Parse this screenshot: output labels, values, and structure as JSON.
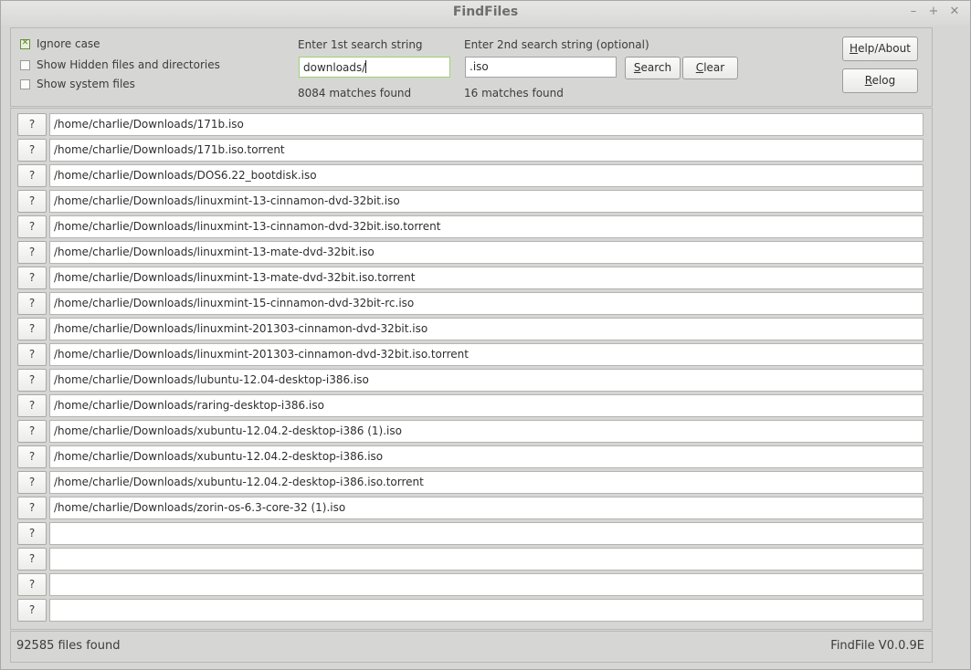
{
  "window": {
    "title": "FindFiles",
    "controls": {
      "minimize": "–",
      "maximize": "+",
      "close": "✕"
    }
  },
  "options": {
    "ignore_case": {
      "label": "Ignore case",
      "checked": true
    },
    "show_hidden": {
      "label": "Show Hidden files and directories",
      "checked": false
    },
    "show_system": {
      "label": "Show system files",
      "checked": false
    }
  },
  "search1": {
    "label": "Enter 1st search string",
    "value": "downloads/",
    "matches": "8084 matches found"
  },
  "search2": {
    "label": "Enter 2nd search string (optional)",
    "value": ".iso",
    "matches": "16 matches found"
  },
  "buttons": {
    "search": {
      "first": "S",
      "rest": "earch"
    },
    "clear": {
      "first": "C",
      "rest": "lear"
    },
    "help": {
      "first": "H",
      "rest": "elp/About"
    },
    "relog": {
      "first": "R",
      "rest": "elog"
    }
  },
  "results": {
    "row_button_label": "?",
    "rows": [
      "/home/charlie/Downloads/171b.iso",
      "/home/charlie/Downloads/171b.iso.torrent",
      "/home/charlie/Downloads/DOS6.22_bootdisk.iso",
      "/home/charlie/Downloads/linuxmint-13-cinnamon-dvd-32bit.iso",
      "/home/charlie/Downloads/linuxmint-13-cinnamon-dvd-32bit.iso.torrent",
      "/home/charlie/Downloads/linuxmint-13-mate-dvd-32bit.iso",
      "/home/charlie/Downloads/linuxmint-13-mate-dvd-32bit.iso.torrent",
      "/home/charlie/Downloads/linuxmint-15-cinnamon-dvd-32bit-rc.iso",
      "/home/charlie/Downloads/linuxmint-201303-cinnamon-dvd-32bit.iso",
      "/home/charlie/Downloads/linuxmint-201303-cinnamon-dvd-32bit.iso.torrent",
      "/home/charlie/Downloads/lubuntu-12.04-desktop-i386.iso",
      "/home/charlie/Downloads/raring-desktop-i386.iso",
      "/home/charlie/Downloads/xubuntu-12.04.2-desktop-i386 (1).iso",
      "/home/charlie/Downloads/xubuntu-12.04.2-desktop-i386.iso",
      "/home/charlie/Downloads/xubuntu-12.04.2-desktop-i386.iso.torrent",
      "/home/charlie/Downloads/zorin-os-6.3-core-32 (1).iso",
      "",
      "",
      "",
      ""
    ]
  },
  "status": {
    "files_found": "92585 files found",
    "version": "FindFile V0.0.9E"
  }
}
